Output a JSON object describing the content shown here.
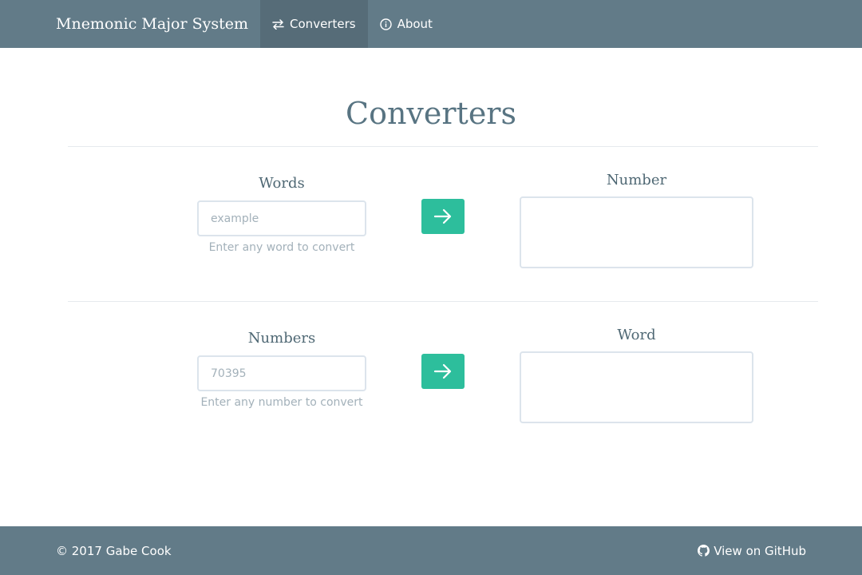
{
  "navbar": {
    "brand": "Mnemonic Major System",
    "items": [
      {
        "label": "Converters",
        "icon": "swap-arrows-icon",
        "active": true
      },
      {
        "label": "About",
        "icon": "info-circle-icon",
        "active": false
      }
    ]
  },
  "main": {
    "title": "Converters",
    "word_to_number": {
      "input_label": "Words",
      "input_value": "",
      "input_placeholder": "example",
      "help_text": "Enter any word to convert",
      "button_icon": "arrow-right-icon",
      "output_label": "Number",
      "output_value": ""
    },
    "number_to_word": {
      "input_label": "Numbers",
      "input_value": "",
      "input_placeholder": "70395",
      "help_text": "Enter any number to convert",
      "button_icon": "arrow-right-icon",
      "output_label": "Word",
      "output_value": ""
    }
  },
  "footer": {
    "copyright": "© 2017 Gabe Cook",
    "github_label": "View on GitHub",
    "github_icon": "github-icon"
  },
  "colors": {
    "navbar": "#627b88",
    "nav_active": "#566c78",
    "accent": "#2dbe9c",
    "title": "#587482",
    "muted": "#a3b1ba",
    "border": "#dce4ec"
  }
}
